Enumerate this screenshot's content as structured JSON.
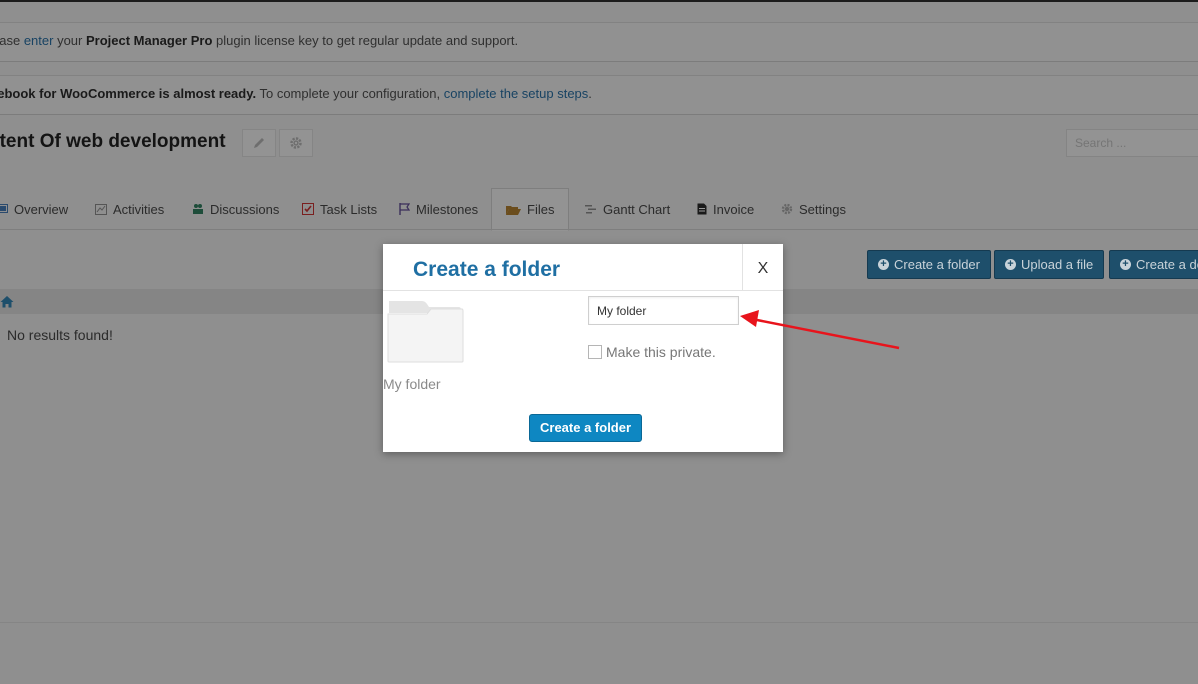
{
  "notices": {
    "license": {
      "prefix": "ease ",
      "link": "enter",
      "middle": " your ",
      "bold": "Project Manager Pro",
      "suffix": " plugin license key to get regular update and support."
    },
    "facebook": {
      "bold": "cebook for WooCommerce is almost ready.",
      "text": " To complete your configuration, ",
      "link": "complete the setup steps",
      "suffix": "."
    }
  },
  "project": {
    "title": "ntent Of web development",
    "search_placeholder": "Search ..."
  },
  "tabs": [
    {
      "label": "Overview",
      "icon": "overview-icon"
    },
    {
      "label": "Activities",
      "icon": "activities-icon"
    },
    {
      "label": "Discussions",
      "icon": "discussions-icon"
    },
    {
      "label": "Task Lists",
      "icon": "task-lists-icon"
    },
    {
      "label": "Milestones",
      "icon": "milestones-icon"
    },
    {
      "label": "Files",
      "icon": "folder-open-icon",
      "active": true
    },
    {
      "label": "Gantt Chart",
      "icon": "gantt-icon"
    },
    {
      "label": "Invoice",
      "icon": "invoice-icon"
    },
    {
      "label": "Settings",
      "icon": "gear-icon"
    }
  ],
  "actions": {
    "create_folder": "Create a folder",
    "upload_file": "Upload a file",
    "create_doc": "Create a do"
  },
  "files": {
    "empty_message": "No results found!"
  },
  "modal": {
    "title": "Create a folder",
    "close": "X",
    "folder_label": "My folder",
    "input_value": "My folder",
    "private_label": "Make this private.",
    "private_checked": false,
    "submit": "Create a folder"
  },
  "colors": {
    "overlay": "#8f8f8f",
    "accent": "#0e87c2",
    "title_blue": "#1f6fa3",
    "annotation_arrow": "#e8141c"
  }
}
